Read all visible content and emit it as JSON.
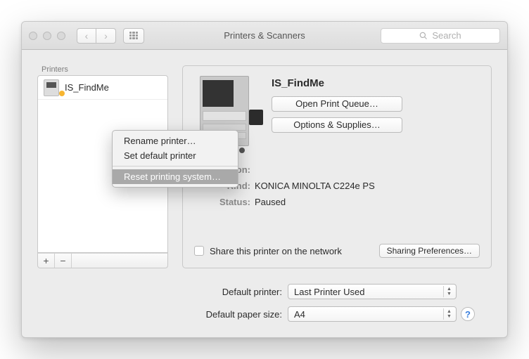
{
  "titlebar": {
    "title": "Printers & Scanners",
    "search_placeholder": "Search"
  },
  "sidebar": {
    "heading": "Printers",
    "items": [
      {
        "name": "IS_FindMe",
        "status_color": "#f7b531"
      }
    ]
  },
  "context_menu": {
    "items": [
      {
        "label": "Rename printer…"
      },
      {
        "label": "Set default printer"
      }
    ],
    "after_sep": [
      {
        "label": "Reset printing system…",
        "highlighted": true
      }
    ]
  },
  "detail": {
    "printer_name": "IS_FindMe",
    "open_queue_label": "Open Print Queue…",
    "options_supplies_label": "Options & Supplies…",
    "location_label": "Location:",
    "location_value": "",
    "kind_label": "Kind:",
    "kind_value": "KONICA MINOLTA C224e PS",
    "status_label": "Status:",
    "status_value": "Paused",
    "share_label": "Share this printer on the network",
    "sharing_prefs_label": "Sharing Preferences…"
  },
  "footer": {
    "default_printer_label": "Default printer:",
    "default_printer_value": "Last Printer Used",
    "default_paper_label": "Default paper size:",
    "default_paper_value": "A4"
  }
}
